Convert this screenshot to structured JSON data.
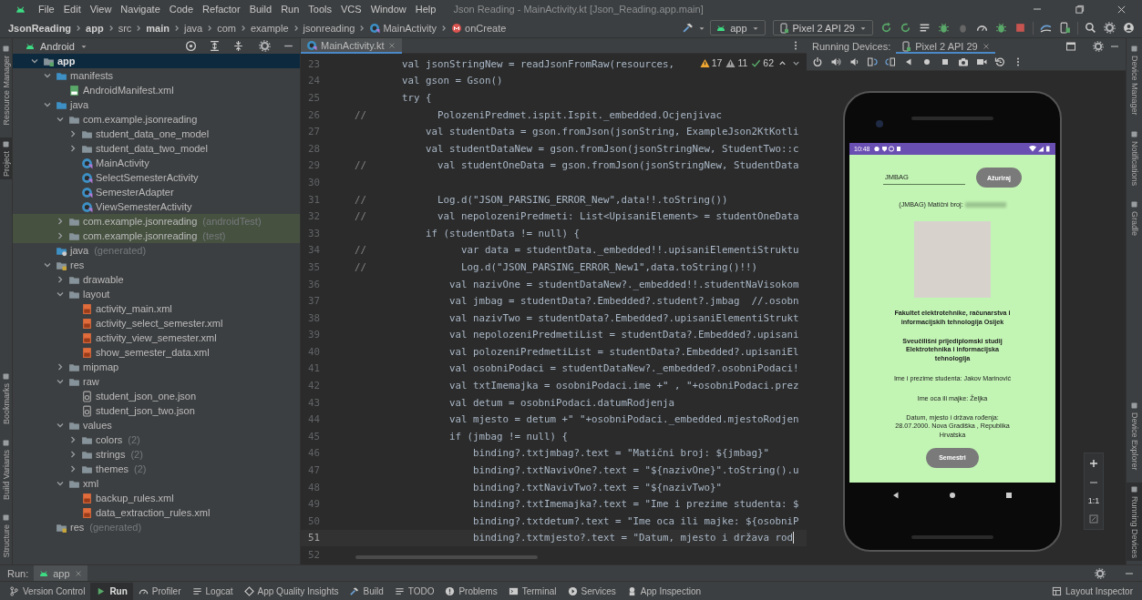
{
  "window": {
    "title": "Json Reading - MainActivity.kt [Json_Reading.app.main]"
  },
  "menu": [
    "File",
    "Edit",
    "View",
    "Navigate",
    "Code",
    "Refactor",
    "Build",
    "Run",
    "Tools",
    "VCS",
    "Window",
    "Help"
  ],
  "breadcrumbs": [
    {
      "label": "JsonReading",
      "kind": "folder",
      "bold": true
    },
    {
      "label": "app",
      "kind": "folder",
      "bold": true
    },
    {
      "label": "src",
      "kind": "folder",
      "bold": false
    },
    {
      "label": "main",
      "kind": "folder",
      "bold": true
    },
    {
      "label": "java",
      "kind": "folder",
      "bold": false
    },
    {
      "label": "com",
      "kind": "folder",
      "bold": false
    },
    {
      "label": "example",
      "kind": "folder",
      "bold": false
    },
    {
      "label": "jsonreading",
      "kind": "folder",
      "bold": false
    },
    {
      "label": "MainActivity",
      "kind": "class",
      "bold": false
    },
    {
      "label": "onCreate",
      "kind": "method",
      "bold": false
    }
  ],
  "toolbar": {
    "configuration": "app",
    "device": "Pixel 2 API 29"
  },
  "left_strip": [
    {
      "label": "Resource Manager",
      "selected": false
    },
    {
      "label": "Project",
      "selected": true
    },
    {
      "label": "Bookmarks",
      "selected": false
    },
    {
      "label": "Build Variants",
      "selected": false
    },
    {
      "label": "Structure",
      "selected": false
    }
  ],
  "project": {
    "view": "Android",
    "tree": [
      {
        "label": "app",
        "kind": "module",
        "expanded": true,
        "selected": true,
        "children": [
          {
            "label": "manifests",
            "kind": "folder",
            "expanded": true,
            "selected": false,
            "children": [
              {
                "label": "AndroidManifest.xml",
                "kind": "manifest",
                "selected": false
              }
            ]
          },
          {
            "label": "java",
            "kind": "folder",
            "expanded": true,
            "selected": false,
            "children": [
              {
                "label": "com.example.jsonreading",
                "kind": "package",
                "expanded": true,
                "selected": false,
                "highlighted": false,
                "children": [
                  {
                    "label": "student_data_one_model",
                    "kind": "package",
                    "expanded": false,
                    "selected": false
                  },
                  {
                    "label": "student_data_two_model",
                    "kind": "package",
                    "expanded": false,
                    "selected": false
                  },
                  {
                    "label": "MainActivity",
                    "kind": "kotlin",
                    "selected": false
                  },
                  {
                    "label": "SelectSemesterActivity",
                    "kind": "kotlin",
                    "selected": false
                  },
                  {
                    "label": "SemesterAdapter",
                    "kind": "kotlin",
                    "selected": false
                  },
                  {
                    "label": "ViewSemesterActivity",
                    "kind": "kotlin",
                    "selected": false
                  }
                ]
              },
              {
                "label": "com.example.jsonreading",
                "note": "(androidTest)",
                "kind": "package",
                "expanded": false,
                "selected": false,
                "highlighted": true
              },
              {
                "label": "com.example.jsonreading",
                "note": "(test)",
                "kind": "package",
                "expanded": false,
                "selected": false,
                "highlighted": true
              }
            ]
          },
          {
            "label": "java",
            "note": "(generated)",
            "kind": "generated",
            "selected": false
          },
          {
            "label": "res",
            "kind": "resfolder",
            "expanded": true,
            "selected": false,
            "children": [
              {
                "label": "drawable",
                "kind": "package",
                "expanded": false,
                "selected": false
              },
              {
                "label": "layout",
                "kind": "package",
                "expanded": true,
                "selected": false,
                "children": [
                  {
                    "label": "activity_main.xml",
                    "kind": "xml",
                    "selected": false
                  },
                  {
                    "label": "activity_select_semester.xml",
                    "kind": "xml",
                    "selected": false
                  },
                  {
                    "label": "activity_view_semester.xml",
                    "kind": "xml",
                    "selected": false
                  },
                  {
                    "label": "show_semester_data.xml",
                    "kind": "xml",
                    "selected": false
                  }
                ]
              },
              {
                "label": "mipmap",
                "kind": "package",
                "expanded": false,
                "selected": false
              },
              {
                "label": "raw",
                "kind": "package",
                "expanded": true,
                "selected": false,
                "children": [
                  {
                    "label": "student_json_one.json",
                    "kind": "json",
                    "selected": false
                  },
                  {
                    "label": "student_json_two.json",
                    "kind": "json",
                    "selected": false
                  }
                ]
              },
              {
                "label": "values",
                "kind": "package",
                "expanded": true,
                "selected": false,
                "children": [
                  {
                    "label": "colors",
                    "note": "(2)",
                    "kind": "package",
                    "expanded": false,
                    "selected": false
                  },
                  {
                    "label": "strings",
                    "note": "(2)",
                    "kind": "package",
                    "expanded": false,
                    "selected": false
                  },
                  {
                    "label": "themes",
                    "note": "(2)",
                    "kind": "package",
                    "expanded": false,
                    "selected": false
                  }
                ]
              },
              {
                "label": "xml",
                "kind": "package",
                "expanded": true,
                "selected": false,
                "children": [
                  {
                    "label": "backup_rules.xml",
                    "kind": "xml",
                    "selected": false
                  },
                  {
                    "label": "data_extraction_rules.xml",
                    "kind": "xml",
                    "selected": false
                  }
                ]
              }
            ]
          },
          {
            "label": "res",
            "note": "(generated)",
            "kind": "resfolder",
            "selected": false
          }
        ]
      }
    ]
  },
  "editor": {
    "tab": {
      "label": "MainActivity.kt",
      "selected": true
    },
    "inspections": [
      {
        "kind": "warning",
        "count": "17"
      },
      {
        "kind": "weak",
        "count": "11"
      },
      {
        "kind": "ok",
        "count": "62"
      }
    ],
    "lines": [
      {
        "number": "23",
        "current": false,
        "code": "    val jsonStringNew = readJsonFromRaw(resources,"
      },
      {
        "number": "24",
        "current": false,
        "code": "    val gson = Gson()"
      },
      {
        "number": "25",
        "current": false,
        "code": "    try {"
      },
      {
        "number": "26",
        "current": false,
        "marker": "//",
        "code": "          PolozeniPredmet.ispit.Ispit._embedded.Ocjenjivac"
      },
      {
        "number": "27",
        "current": false,
        "code": "        val studentData = gson.fromJson(jsonString, ExampleJson2KtKotli"
      },
      {
        "number": "28",
        "current": false,
        "code": "        val studentDataNew = gson.fromJson(jsonStringNew, StudentTwo::c"
      },
      {
        "number": "29",
        "current": false,
        "marker": "//",
        "code": "          val studentOneData = gson.fromJson(jsonStringNew, StudentData"
      },
      {
        "number": "30",
        "current": false
      },
      {
        "number": "31",
        "current": false,
        "marker": "//",
        "code": "          Log.d(\"JSON_PARSING_ERROR_New\",data!!.toString())"
      },
      {
        "number": "32",
        "current": false,
        "marker": "//",
        "code": "          val nepolozeniPredmeti: List<UpisaniElement> = studentOneData"
      },
      {
        "number": "33",
        "current": false,
        "code": "        if (studentData != null) {"
      },
      {
        "number": "34",
        "current": false,
        "marker": "//",
        "code": "              var data = studentData._embedded!!.upisaniElementiStruktu"
      },
      {
        "number": "35",
        "current": false,
        "marker": "//",
        "code": "              Log.d(\"JSON_PARSING_ERROR_New1\",data.toString()!!)"
      },
      {
        "number": "36",
        "current": false,
        "code": "            val nazivOne = studentDataNew?._embedded!!.studentNaVisokom"
      },
      {
        "number": "37",
        "current": false,
        "code": "            val jmbag = studentData?.Embedded?.student?.jmbag  //.osobn"
      },
      {
        "number": "38",
        "current": false,
        "code": "            val nazivTwo = studentData?.Embedded?.upisaniElementiStrukt"
      },
      {
        "number": "39",
        "current": false,
        "code": "            val nepolozeniPredmetiList = studentData?.Embedded?.upisani"
      },
      {
        "number": "40",
        "current": false,
        "code": "            val polozeniPredmetiList = studentData?.Embedded?.upisaniEl"
      },
      {
        "number": "41",
        "current": false,
        "code": "            val osobniPodaci = studentDataNew?._embedded?.osobniPodaci!"
      },
      {
        "number": "42",
        "current": false,
        "code": "            val txtImemajka = osobniPodaci.ime +\" , \"+osobniPodaci.prez"
      },
      {
        "number": "43",
        "current": false,
        "code": "            val detum = osobniPodaci.datumRodjenja"
      },
      {
        "number": "44",
        "current": false,
        "code": "            val mjesto = detum +\" \"+osobniPodaci._embedded.mjestoRodjen"
      },
      {
        "number": "45",
        "current": false,
        "code": "            if (jmbag != null) {"
      },
      {
        "number": "46",
        "current": false,
        "code": "                binding?.txtjmbag?.text = \"Matični broj: ${jmbag}\""
      },
      {
        "number": "47",
        "current": false,
        "code": "                binding?.txtNavivOne?.text = \"${nazivOne}\".toString().u"
      },
      {
        "number": "48",
        "current": false,
        "code": "                binding?.txtNavivTwo?.text = \"${nazivTwo}\""
      },
      {
        "number": "49",
        "current": false,
        "code": "                binding?.txtImemajka?.text = \"Ime i prezime studenta: $"
      },
      {
        "number": "50",
        "current": false,
        "code": "                binding?.txtdetum?.text = \"Ime oca ili majke: ${osobniP"
      },
      {
        "number": "51",
        "current": true,
        "code": "                binding?.txtmjesto?.text = \"Datum, mjesto i država rod"
      },
      {
        "number": "52",
        "current": false
      }
    ]
  },
  "devices": {
    "label": "Running Devices:",
    "tab": "Pixel 2 API 29",
    "zoom_label": "1:1",
    "phone": {
      "time": "10:48",
      "field": {
        "placeholder": "JMBAG"
      },
      "update_button": "Ažuriraj",
      "id_label": "(JMBAG) Matični broj:",
      "faculty": "Fakultet elektrotehnike, računarstva i informacijskih tehnologija Osijek",
      "study": "Sveučilišni prijediplomski studij Elektrotehnika i informacijska tehnologija",
      "student": "Ime i prezime studenta: Jakov Marinović",
      "parent": "Ime oca ili majke: Željka",
      "birth": "Datum, mjesto i država rođenja: 28.07.2000. Nova Gradiška , Republika Hrvatska",
      "semesters_button": "Semestri"
    }
  },
  "right_strip": [
    {
      "label": "Device Manager",
      "selected": false
    },
    {
      "label": "Notifications",
      "selected": false
    },
    {
      "label": "Gradle",
      "selected": false
    },
    {
      "label": "Device Explorer",
      "selected": false
    },
    {
      "label": "Running Devices",
      "selected": true
    }
  ],
  "run_bar": {
    "label": "Run:",
    "tab": "app"
  },
  "bottom_tools": [
    {
      "label": "Version Control",
      "selected": false
    },
    {
      "label": "Run",
      "selected": true
    },
    {
      "label": "Profiler",
      "selected": false
    },
    {
      "label": "Logcat",
      "selected": false
    },
    {
      "label": "App Quality Insights",
      "selected": false
    },
    {
      "label": "Build",
      "selected": false
    },
    {
      "label": "TODO",
      "selected": false
    },
    {
      "label": "Problems",
      "selected": false
    },
    {
      "label": "Terminal",
      "selected": false
    },
    {
      "label": "Services",
      "selected": false
    },
    {
      "label": "App Inspection",
      "selected": false
    }
  ],
  "layout_inspector": "Layout Inspector"
}
